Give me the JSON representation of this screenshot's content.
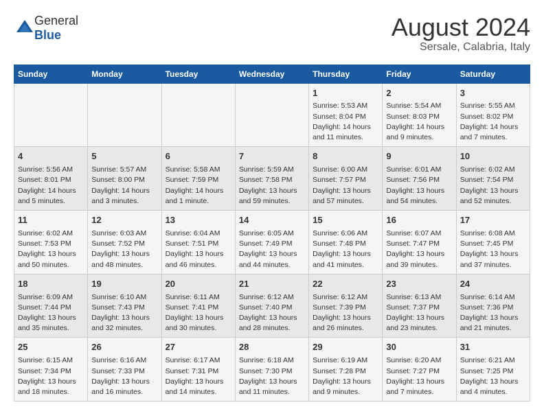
{
  "header": {
    "logo_general": "General",
    "logo_blue": "Blue",
    "month_year": "August 2024",
    "location": "Sersale, Calabria, Italy"
  },
  "weekdays": [
    "Sunday",
    "Monday",
    "Tuesday",
    "Wednesday",
    "Thursday",
    "Friday",
    "Saturday"
  ],
  "weeks": [
    [
      {
        "day": "",
        "info": ""
      },
      {
        "day": "",
        "info": ""
      },
      {
        "day": "",
        "info": ""
      },
      {
        "day": "",
        "info": ""
      },
      {
        "day": "1",
        "info": "Sunrise: 5:53 AM\nSunset: 8:04 PM\nDaylight: 14 hours\nand 11 minutes."
      },
      {
        "day": "2",
        "info": "Sunrise: 5:54 AM\nSunset: 8:03 PM\nDaylight: 14 hours\nand 9 minutes."
      },
      {
        "day": "3",
        "info": "Sunrise: 5:55 AM\nSunset: 8:02 PM\nDaylight: 14 hours\nand 7 minutes."
      }
    ],
    [
      {
        "day": "4",
        "info": "Sunrise: 5:56 AM\nSunset: 8:01 PM\nDaylight: 14 hours\nand 5 minutes."
      },
      {
        "day": "5",
        "info": "Sunrise: 5:57 AM\nSunset: 8:00 PM\nDaylight: 14 hours\nand 3 minutes."
      },
      {
        "day": "6",
        "info": "Sunrise: 5:58 AM\nSunset: 7:59 PM\nDaylight: 14 hours\nand 1 minute."
      },
      {
        "day": "7",
        "info": "Sunrise: 5:59 AM\nSunset: 7:58 PM\nDaylight: 13 hours\nand 59 minutes."
      },
      {
        "day": "8",
        "info": "Sunrise: 6:00 AM\nSunset: 7:57 PM\nDaylight: 13 hours\nand 57 minutes."
      },
      {
        "day": "9",
        "info": "Sunrise: 6:01 AM\nSunset: 7:56 PM\nDaylight: 13 hours\nand 54 minutes."
      },
      {
        "day": "10",
        "info": "Sunrise: 6:02 AM\nSunset: 7:54 PM\nDaylight: 13 hours\nand 52 minutes."
      }
    ],
    [
      {
        "day": "11",
        "info": "Sunrise: 6:02 AM\nSunset: 7:53 PM\nDaylight: 13 hours\nand 50 minutes."
      },
      {
        "day": "12",
        "info": "Sunrise: 6:03 AM\nSunset: 7:52 PM\nDaylight: 13 hours\nand 48 minutes."
      },
      {
        "day": "13",
        "info": "Sunrise: 6:04 AM\nSunset: 7:51 PM\nDaylight: 13 hours\nand 46 minutes."
      },
      {
        "day": "14",
        "info": "Sunrise: 6:05 AM\nSunset: 7:49 PM\nDaylight: 13 hours\nand 44 minutes."
      },
      {
        "day": "15",
        "info": "Sunrise: 6:06 AM\nSunset: 7:48 PM\nDaylight: 13 hours\nand 41 minutes."
      },
      {
        "day": "16",
        "info": "Sunrise: 6:07 AM\nSunset: 7:47 PM\nDaylight: 13 hours\nand 39 minutes."
      },
      {
        "day": "17",
        "info": "Sunrise: 6:08 AM\nSunset: 7:45 PM\nDaylight: 13 hours\nand 37 minutes."
      }
    ],
    [
      {
        "day": "18",
        "info": "Sunrise: 6:09 AM\nSunset: 7:44 PM\nDaylight: 13 hours\nand 35 minutes."
      },
      {
        "day": "19",
        "info": "Sunrise: 6:10 AM\nSunset: 7:43 PM\nDaylight: 13 hours\nand 32 minutes."
      },
      {
        "day": "20",
        "info": "Sunrise: 6:11 AM\nSunset: 7:41 PM\nDaylight: 13 hours\nand 30 minutes."
      },
      {
        "day": "21",
        "info": "Sunrise: 6:12 AM\nSunset: 7:40 PM\nDaylight: 13 hours\nand 28 minutes."
      },
      {
        "day": "22",
        "info": "Sunrise: 6:12 AM\nSunset: 7:39 PM\nDaylight: 13 hours\nand 26 minutes."
      },
      {
        "day": "23",
        "info": "Sunrise: 6:13 AM\nSunset: 7:37 PM\nDaylight: 13 hours\nand 23 minutes."
      },
      {
        "day": "24",
        "info": "Sunrise: 6:14 AM\nSunset: 7:36 PM\nDaylight: 13 hours\nand 21 minutes."
      }
    ],
    [
      {
        "day": "25",
        "info": "Sunrise: 6:15 AM\nSunset: 7:34 PM\nDaylight: 13 hours\nand 18 minutes."
      },
      {
        "day": "26",
        "info": "Sunrise: 6:16 AM\nSunset: 7:33 PM\nDaylight: 13 hours\nand 16 minutes."
      },
      {
        "day": "27",
        "info": "Sunrise: 6:17 AM\nSunset: 7:31 PM\nDaylight: 13 hours\nand 14 minutes."
      },
      {
        "day": "28",
        "info": "Sunrise: 6:18 AM\nSunset: 7:30 PM\nDaylight: 13 hours\nand 11 minutes."
      },
      {
        "day": "29",
        "info": "Sunrise: 6:19 AM\nSunset: 7:28 PM\nDaylight: 13 hours\nand 9 minutes."
      },
      {
        "day": "30",
        "info": "Sunrise: 6:20 AM\nSunset: 7:27 PM\nDaylight: 13 hours\nand 7 minutes."
      },
      {
        "day": "31",
        "info": "Sunrise: 6:21 AM\nSunset: 7:25 PM\nDaylight: 13 hours\nand 4 minutes."
      }
    ]
  ]
}
